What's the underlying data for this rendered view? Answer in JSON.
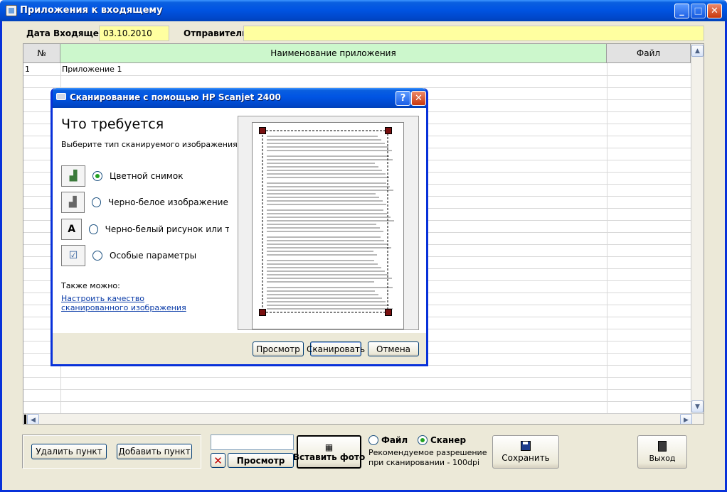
{
  "window": {
    "title": "Приложения к входящему"
  },
  "header": {
    "date_label": "Дата Входящего",
    "date_value": "03.10.2010",
    "sender_label": "Отправитель",
    "sender_value": ""
  },
  "grid": {
    "columns": [
      "№",
      "Наименование приложения",
      "Файл"
    ],
    "rows": [
      {
        "num": "1",
        "name": "Приложение 1",
        "file": ""
      }
    ]
  },
  "dialog": {
    "title": "Сканирование с помощью HP Scanjet 2400",
    "heading": "Что требуется",
    "subheading": "Выберите тип сканируемого изображения.",
    "options": [
      {
        "label": "Цветной снимок",
        "selected": true,
        "icon": "color-photo-icon"
      },
      {
        "label": "Черно-белое изображение (оттенки",
        "selected": false,
        "icon": "grayscale-photo-icon"
      },
      {
        "label": "Черно-белый рисунок или текст",
        "selected": false,
        "icon": "bw-text-icon"
      },
      {
        "label": "Особые параметры",
        "selected": false,
        "icon": "custom-settings-icon"
      }
    ],
    "also_label": "Также можно:",
    "quality_link": "Настроить качество сканированного изображения",
    "preview_button": "Просмотр",
    "scan_button": "Сканировать",
    "cancel_button": "Отмена",
    "help_button": "?",
    "close_button": "✕"
  },
  "bottom": {
    "delete_button": "Удалить пункт",
    "add_button": "Добавить пункт",
    "path_value": "",
    "view_button": "Просмотр",
    "insert_photo_button": "Вставить фото",
    "source_file_label": "Файл",
    "source_scanner_label": "Сканер",
    "source_selected": "Сканер",
    "recommendation_line1": "Рекомендуемое разрешение",
    "recommendation_line2": "при сканировании - 100dpi",
    "save_button": "Сохранить",
    "exit_button": "Выход"
  },
  "colors": {
    "title_blue": "#0054e3",
    "header_green": "#ccf7cc",
    "field_yellow": "#ffffa0",
    "link_blue": "#0b3ca8"
  }
}
